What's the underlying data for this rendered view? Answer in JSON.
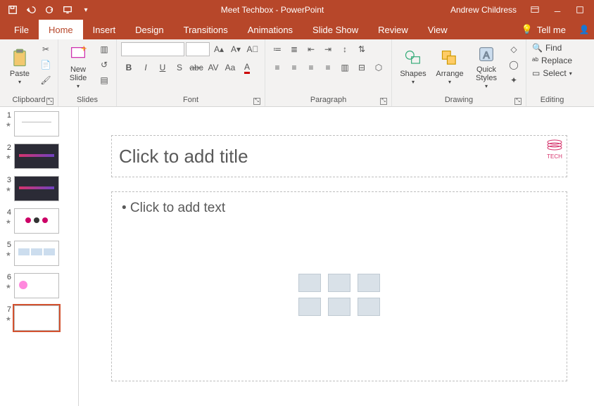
{
  "titlebar": {
    "title": "Meet Techbox - PowerPoint",
    "user": "Andrew Childress"
  },
  "tabs": {
    "items": [
      {
        "label": "File"
      },
      {
        "label": "Home"
      },
      {
        "label": "Insert"
      },
      {
        "label": "Design"
      },
      {
        "label": "Transitions"
      },
      {
        "label": "Animations"
      },
      {
        "label": "Slide Show"
      },
      {
        "label": "Review"
      },
      {
        "label": "View"
      }
    ],
    "active": 1,
    "tellme": "Tell me"
  },
  "ribbon": {
    "clipboard": {
      "label": "Clipboard",
      "paste": "Paste"
    },
    "slides": {
      "label": "Slides",
      "newslide": "New\nSlide"
    },
    "font": {
      "label": "Font",
      "name": "",
      "size": ""
    },
    "paragraph": {
      "label": "Paragraph"
    },
    "drawing": {
      "label": "Drawing",
      "shapes": "Shapes",
      "arrange": "Arrange",
      "quick": "Quick\nStyles"
    },
    "editing": {
      "label": "Editing",
      "find": "Find",
      "replace": "Replace",
      "select": "Select"
    }
  },
  "slides": {
    "items": [
      {
        "n": "1",
        "selected": false,
        "theme": "light"
      },
      {
        "n": "2",
        "selected": false,
        "theme": "dark"
      },
      {
        "n": "3",
        "selected": false,
        "theme": "dark"
      },
      {
        "n": "4",
        "selected": false,
        "theme": "light"
      },
      {
        "n": "5",
        "selected": false,
        "theme": "light"
      },
      {
        "n": "6",
        "selected": false,
        "theme": "light"
      },
      {
        "n": "7",
        "selected": true,
        "theme": "blank"
      }
    ]
  },
  "canvas": {
    "title_placeholder": "Click to add title",
    "body_placeholder": "• Click to add text",
    "logo_text": "TECH"
  }
}
